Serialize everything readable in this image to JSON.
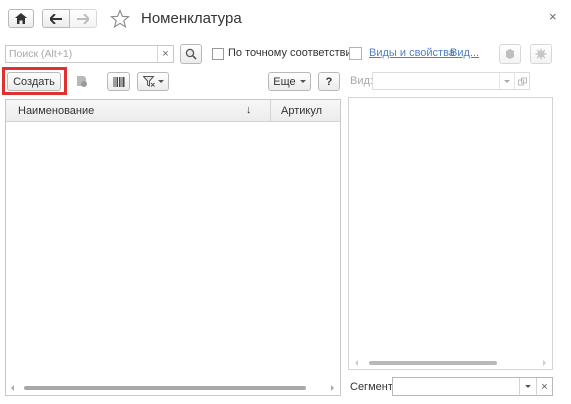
{
  "window": {
    "title": "Номенклатура",
    "close_glyph": "×"
  },
  "search": {
    "placeholder": "Поиск (Alt+1)",
    "clear_glyph": "×",
    "exact_match_label": "По точному соответствию"
  },
  "properties": {
    "link_kinds": "Виды и свойства",
    "link_kinds_short": "Вид..."
  },
  "toolbar": {
    "create_label": "Создать",
    "more_label": "Еще",
    "help_label": "?"
  },
  "table": {
    "columns": [
      "Наименование",
      "Артикул"
    ],
    "sort_glyph": "↓",
    "rows": []
  },
  "right_panel": {
    "kind_label": "Вид:",
    "segment_label": "Сегмент:",
    "clear_glyph": "×"
  },
  "colors": {
    "highlight": "#e03030",
    "link": "#4f7fc1",
    "scrollbar_thumb": "#a8a8a8"
  }
}
